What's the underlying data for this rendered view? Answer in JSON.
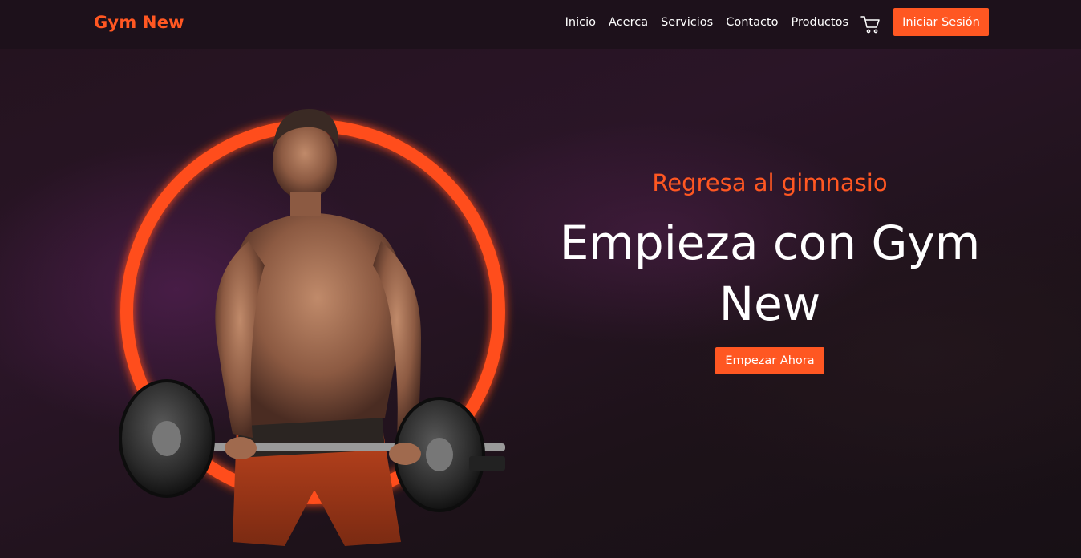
{
  "nav": {
    "brand": "Gym New",
    "links": [
      "Inicio",
      "Acerca",
      "Servicios",
      "Contacto",
      "Productos"
    ],
    "cart_icon": "shopping-cart-icon",
    "login_label": "Iniciar Sesión"
  },
  "hero": {
    "subtitle": "Regresa al gimnasio",
    "headline": "Empieza con Gym New",
    "cta_label": "Empezar Ahora"
  },
  "colors": {
    "accent": "#ff5722",
    "navbar_bg": "#1d111b",
    "hero_bg": "#24131f"
  }
}
